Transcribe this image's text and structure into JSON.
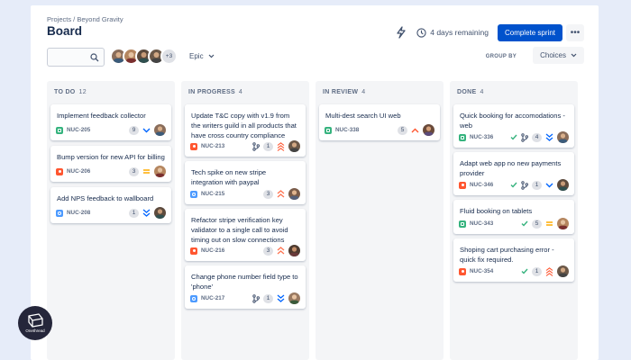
{
  "breadcrumb": "Projects / Beyond Gravity",
  "title": "Board",
  "header": {
    "remaining": "4 days remaining",
    "complete_label": "Complete sprint",
    "more_label": "•••"
  },
  "toolbar": {
    "avatar_more": "+3",
    "epic_label": "Epic",
    "groupby_label": "GROUP BY",
    "choices_label": "Choices"
  },
  "colors": {
    "accent": "#0052cc",
    "story": "#36b37e",
    "bug": "#ff5630",
    "task": "#4c9aff"
  },
  "columns": [
    {
      "name": "TO DO",
      "count": "12",
      "cards": [
        {
          "text": "Implement feedback collector",
          "key": "NUC-205",
          "type": "story",
          "estimate": "9",
          "priority": "low",
          "avatar": "a"
        },
        {
          "text": "Bump version for new API for billing",
          "key": "NUC-206",
          "type": "bug",
          "estimate": "3",
          "priority": "medium",
          "avatar": "b"
        },
        {
          "text": "Add NPS feedback to wallboard",
          "key": "NUC-208",
          "type": "task",
          "estimate": "1",
          "priority": "lowest",
          "avatar": "c"
        }
      ]
    },
    {
      "name": "IN PROGRESS",
      "count": "4",
      "cards": [
        {
          "text": "Update T&C copy with v1.9 from the writers guild in all products that have cross country compliance",
          "key": "NUC-213",
          "type": "bug",
          "estimate": "1",
          "priority": "highest",
          "branch": true,
          "avatar": "d"
        },
        {
          "text": "Tech spike on new stripe integration with paypal",
          "key": "NUC-215",
          "type": "task",
          "estimate": "3",
          "priority": "high",
          "avatar": "e"
        },
        {
          "text": "Refactor stripe verification key validator to a single call to avoid timing out on slow connections",
          "key": "NUC-216",
          "type": "bug",
          "estimate": "3",
          "priority": "high",
          "avatar": "f"
        },
        {
          "text": "Change phone number field type to 'phone'",
          "key": "NUC-217",
          "type": "task",
          "estimate": "1",
          "priority": "lowest",
          "branch": true,
          "avatar": "g"
        }
      ]
    },
    {
      "name": "IN REVIEW",
      "count": "4",
      "cards": [
        {
          "text": "Multi-dest search UI web",
          "key": "NUC-338",
          "type": "story",
          "estimate": "5",
          "priority": "high-single",
          "avatar": "h"
        }
      ]
    },
    {
      "name": "DONE",
      "count": "4",
      "cards": [
        {
          "text": "Quick booking for accomodations - web",
          "key": "NUC-336",
          "type": "story",
          "estimate": "4",
          "priority": "lowest",
          "check": true,
          "branch": true,
          "avatar": "a"
        },
        {
          "text": "Adapt web app no new payments provider",
          "key": "NUC-346",
          "type": "bug",
          "estimate": "1",
          "priority": "low",
          "check": true,
          "branch": true,
          "avatar": "c"
        },
        {
          "text": "Fluid booking on tablets",
          "key": "NUC-343",
          "type": "story",
          "estimate": "5",
          "priority": "medium",
          "check": true,
          "avatar": "b"
        },
        {
          "text": "Shoping cart purchasing error - quick fix required.",
          "key": "NUC-354",
          "type": "bug",
          "estimate": "1",
          "priority": "highest",
          "check": true,
          "avatar": "d"
        }
      ]
    }
  ],
  "logo_label": "Onethread"
}
